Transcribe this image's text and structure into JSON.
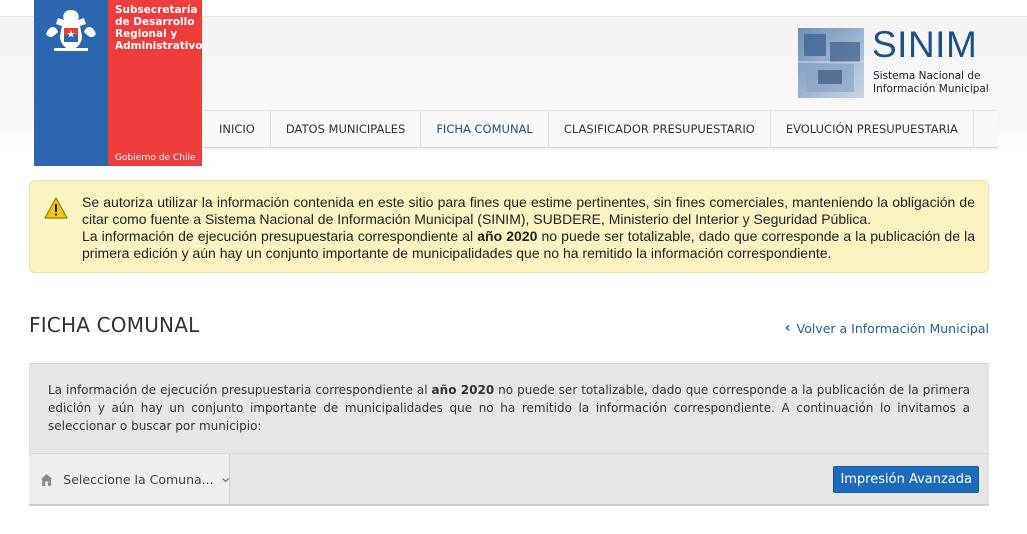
{
  "gov": {
    "org_line1": "Subsecretaría",
    "org_line2": "de Desarrollo",
    "org_line3": "Regional y",
    "org_line4": "Administrativo",
    "footer": "Gobierno de Chile",
    "colors": {
      "blue": "#2a67b0",
      "red": "#ef3d3c"
    }
  },
  "brand": {
    "title": "SINIM",
    "subtitle_line1": "Sistema Nacional de",
    "subtitle_line2": "Información Municipal"
  },
  "nav": {
    "items": [
      {
        "label": "INICIO"
      },
      {
        "label": "DATOS MUNICIPALES"
      },
      {
        "label": "FICHA COMUNAL",
        "active": true
      },
      {
        "label": "CLASIFICADOR PRESUPUESTARIO"
      },
      {
        "label": "EVOLUCIÓN PRESUPUESTARIA"
      }
    ]
  },
  "notice": {
    "icon": "warning-icon",
    "line1": "Se autoriza utilizar la información contenida en este sitio para fines que estime pertinentes, sin fines comerciales, manteniendo la obligación de citar como fuente a Sistema Nacional de Información Municipal (SINIM), SUBDERE, Ministerio del Interior y Seguridad Pública.",
    "line2_before": "La información de ejecución presupuestaria correspondiente al ",
    "line2_bold": "año 2020",
    "line2_after": " no puede ser totalizable, dado que corresponde a la publicación de la primera edición y aún hay un conjunto importante de municipalidades que no ha remitido la información correspondiente."
  },
  "page": {
    "title": "FICHA COMUNAL",
    "back_link": "Volver a Información Municipal"
  },
  "panel": {
    "text_before": "La información de ejecución presupuestaria correspondiente al ",
    "text_bold": "año 2020",
    "text_after": " no puede ser totalizable, dado que corresponde a la publicación de la primera edición y aún hay un conjunto importante de municipalidades que no ha remitido la información correspondiente. A continuación lo invitamos a seleccionar o buscar por municipio:",
    "select_label": "Seleccione la Comuna...",
    "print_button": "Impresión Avanzada"
  }
}
